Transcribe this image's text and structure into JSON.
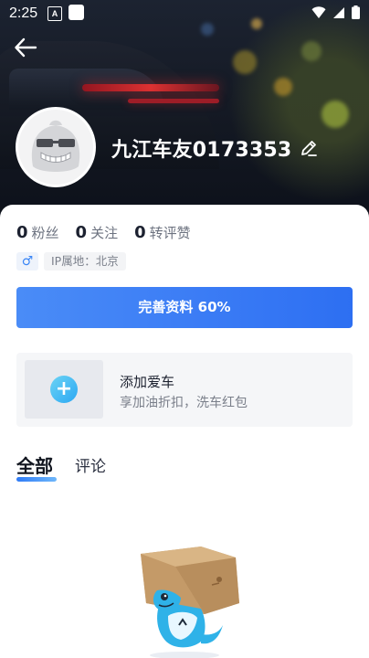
{
  "status_bar": {
    "time": "2:25",
    "notif_badge": "A"
  },
  "profile": {
    "username": "九江车友0173353",
    "stats": [
      {
        "num": "0",
        "label": "粉丝"
      },
      {
        "num": "0",
        "label": "关注"
      },
      {
        "num": "0",
        "label": "转评赞"
      }
    ],
    "gender_symbol": "♂",
    "ip_location": "IP属地：北京"
  },
  "complete_button": {
    "label": "完善资料 60%",
    "percent": 60
  },
  "add_car": {
    "title": "添加爱车",
    "subtitle": "享加油折扣，洗车红包",
    "plus": "+"
  },
  "tabs": [
    {
      "label": "全部",
      "active": true
    },
    {
      "label": "评论",
      "active": false
    }
  ],
  "colors": {
    "accent": "#3b7cf5",
    "accent_light": "#6fb7fa",
    "hero_dark": "#151a25"
  },
  "icons": [
    "back-arrow-icon",
    "edit-pencil-icon",
    "gender-male-icon",
    "plus-icon",
    "wifi-icon",
    "signal-icon",
    "battery-icon"
  ]
}
